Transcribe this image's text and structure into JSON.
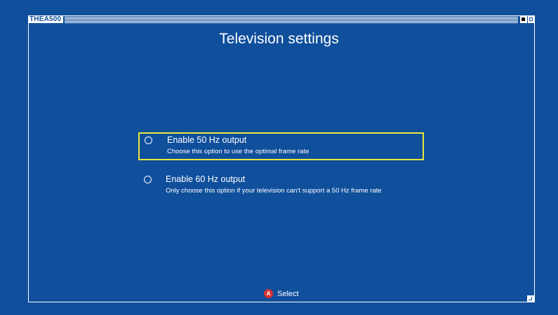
{
  "window": {
    "title": "THEA500"
  },
  "page": {
    "title": "Television settings"
  },
  "options": [
    {
      "label": "Enable 50 Hz output",
      "description": "Choose this option to use the optimal frame rate",
      "selected": true
    },
    {
      "label": "Enable 60 Hz output",
      "description": "Only choose this option if your television can't support a 50 Hz frame rate",
      "selected": false
    }
  ],
  "footer": {
    "button_glyph": "A",
    "action_label": "Select"
  },
  "colors": {
    "background": "#0f4f9c",
    "highlight": "#e8e83a",
    "button_a": "#d9322f",
    "text": "#ffffff"
  }
}
